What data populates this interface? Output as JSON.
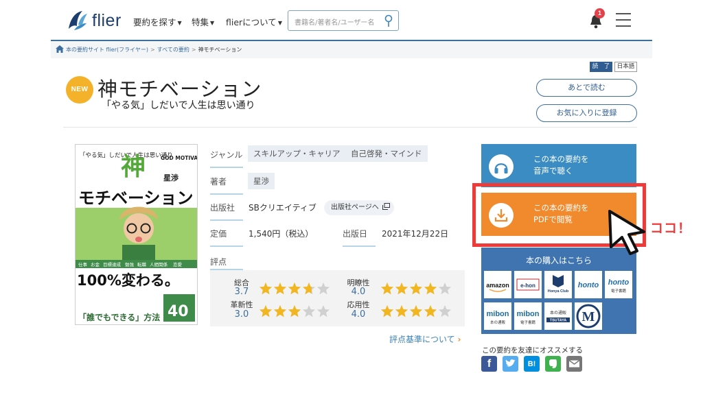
{
  "header": {
    "logo_text": "flier",
    "nav": [
      {
        "label": "要約を探す"
      },
      {
        "label": "特集"
      },
      {
        "label": "flierについて"
      }
    ],
    "search_placeholder": "書籍名/著者名/ユーザー名",
    "notification_count": "1"
  },
  "breadcrumb": {
    "items": [
      "本の要約サイト flier(フライヤー)",
      "すべての要約"
    ],
    "current": "神モチベーション"
  },
  "book": {
    "new_label": "NEW",
    "title": "神モチベーション",
    "subtitle": "「やる気」しだいで人生は思い通り",
    "status": "読　了",
    "language": "日本語",
    "read_later_label": "あとで読む",
    "favorite_label": "お気に入りに登録",
    "cover_text": {
      "top_left": "「やる気」しだいで人生は思い通り",
      "kami": "神",
      "god": "GOD MOTIVATION",
      "author": "星渉",
      "main": "モチベーション",
      "topics": [
        "仕事",
        "お金",
        "目標達成",
        "勉強",
        "転職",
        "人間関係",
        "恋愛"
      ],
      "big": "100%変わる。",
      "bottom": "「誰でもできる」方法",
      "count": "40"
    }
  },
  "info": {
    "genre_label": "ジャンル",
    "genres": [
      "スキルアップ・キャリア",
      "自己啓発・マインド"
    ],
    "author_label": "著者",
    "author": "星渉",
    "publisher_label": "出版社",
    "publisher": "SBクリエイティブ",
    "publisher_page_label": "出版社ページへ",
    "price_label": "定価",
    "price": "1,540円（税込）",
    "date_label": "出版日",
    "date": "2021年12月22日",
    "rating_label": "評点",
    "ratings": [
      {
        "label": "総合",
        "value": "3.7"
      },
      {
        "label": "明瞭性",
        "value": "4.0"
      },
      {
        "label": "革新性",
        "value": "3.0"
      },
      {
        "label": "応用性",
        "value": "4.0"
      }
    ],
    "criteria_link": "評点基準について"
  },
  "actions": {
    "listen": [
      "この本の要約を",
      "音声で聴く"
    ],
    "pdf": [
      "この本の要約を",
      "PDFで閲覧"
    ]
  },
  "buy": {
    "title": "本の購入はこちら",
    "stores": [
      "amazon",
      "e-hon",
      "Honya Club",
      "honto",
      "honto 電子書籍",
      "mibon 本の通販",
      "mibon 電子書籍",
      "TSUTAYA",
      "M"
    ]
  },
  "share": {
    "label": "この要約を友達にオススメする",
    "icons": [
      "facebook-icon",
      "twitter-icon",
      "hatena-icon",
      "evernote-icon",
      "mail-icon"
    ]
  },
  "annotation": {
    "text": "ココ！"
  },
  "colors": {
    "brand_blue": "#2f5d91",
    "listen_blue": "#3a8cc2",
    "pdf_orange": "#f08a2c",
    "highlight_red": "#ef3a3a",
    "star_yellow": "#f2b620",
    "new_badge": "#f3b22a"
  }
}
